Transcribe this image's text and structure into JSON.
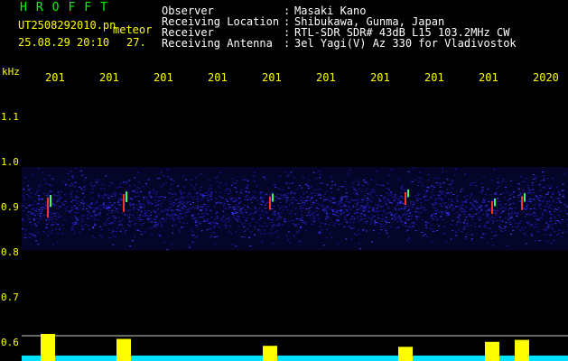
{
  "header": {
    "app_title": "HROFFT",
    "filename": "UT2508292010.pn",
    "meteor_label": "meteor",
    "datetime": "25.08.29 20:10",
    "count": "27."
  },
  "info_rows": [
    {
      "label": "Observer",
      "sep": ":",
      "value": "Masaki Kano"
    },
    {
      "label": "Receiving Location",
      "sep": ":",
      "value": "Shibukawa, Gunma, Japan"
    },
    {
      "label": "Receiver",
      "sep": ":",
      "value": "RTL-SDR SDR# 43dB L15 103.2MHz CW"
    },
    {
      "label": "Receiving Antenna",
      "sep": ":",
      "value": "3el Yagi(V) Az 330 for Vladivostok"
    }
  ],
  "colors": {
    "background": "#000000",
    "title": "#00ff00",
    "header_text": "#ffffff",
    "meta_text": "#ffff00",
    "axis_text": "#ffff00",
    "band": "#1a1aa0",
    "band_bright": "#3b3bff",
    "baseline": "#00e0ff",
    "burst": "#ffff00",
    "echo_red": "#ff3030",
    "echo_green": "#40ff60",
    "guide_line": "#ffffff"
  },
  "chart_data": {
    "type": "heatmap",
    "ylabel": "kHz",
    "ylim": [
      0.58,
      1.16
    ],
    "yticks": [
      1.1,
      1.0,
      0.9,
      0.8,
      0.7,
      0.6
    ],
    "ytick_labels": [
      "1.1",
      "1.0",
      "0.9",
      "0.8",
      "0.7",
      "0.6"
    ],
    "xticks_labels": [
      "201",
      "201",
      "201",
      "201",
      "201",
      "201",
      "201",
      "201",
      "201",
      "2020"
    ],
    "xlim": [
      0,
      20
    ],
    "xtick_positions": [
      2,
      4,
      6,
      8,
      10,
      12,
      14,
      16,
      18,
      20
    ],
    "band": {
      "center_khz": 0.9,
      "low_khz": 0.805,
      "high_khz": 0.99
    },
    "echoes": [
      {
        "x": 0.7,
        "khz": 0.9,
        "strength": 1.0
      },
      {
        "x": 3.5,
        "khz": 0.91,
        "strength": 0.85
      },
      {
        "x": 8.9,
        "khz": 0.91,
        "strength": 0.55
      },
      {
        "x": 13.9,
        "khz": 0.92,
        "strength": 0.5
      },
      {
        "x": 17.1,
        "khz": 0.9,
        "strength": 0.5
      },
      {
        "x": 18.2,
        "khz": 0.91,
        "strength": 0.6
      }
    ],
    "activity_bursts": [
      {
        "x": 0.7,
        "level": 1.0
      },
      {
        "x": 3.5,
        "level": 0.75
      },
      {
        "x": 8.9,
        "level": 0.4
      },
      {
        "x": 13.9,
        "level": 0.35
      },
      {
        "x": 17.1,
        "level": 0.6
      },
      {
        "x": 18.2,
        "level": 0.7
      }
    ]
  }
}
